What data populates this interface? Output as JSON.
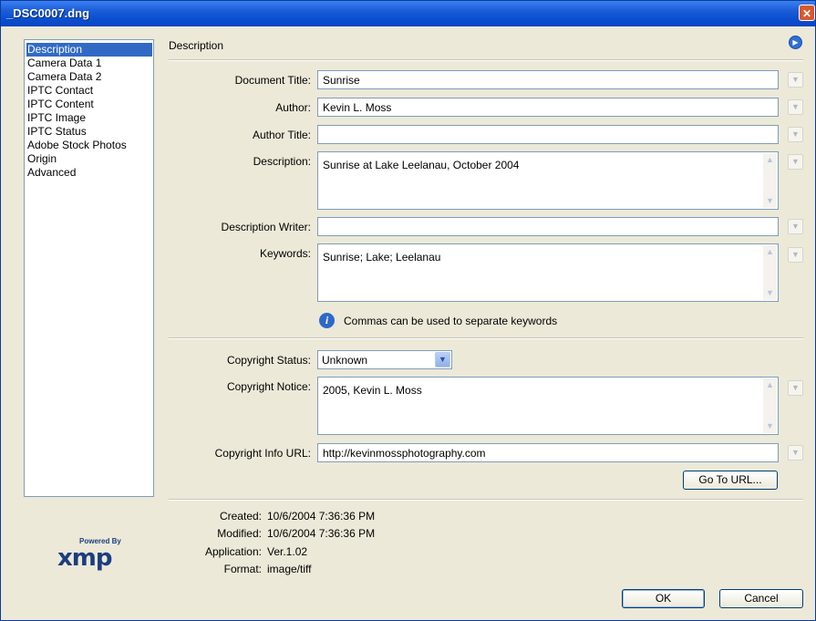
{
  "window": {
    "title": "_DSC0007.dng",
    "close_glyph": "✕"
  },
  "sidebar": {
    "items": [
      {
        "label": "Description",
        "selected": true
      },
      {
        "label": "Camera Data 1"
      },
      {
        "label": "Camera Data 2"
      },
      {
        "label": "IPTC Contact"
      },
      {
        "label": "IPTC Content"
      },
      {
        "label": "IPTC Image"
      },
      {
        "label": "IPTC Status"
      },
      {
        "label": "Adobe Stock Photos"
      },
      {
        "label": "Origin"
      },
      {
        "label": "Advanced"
      }
    ]
  },
  "section": {
    "title": "Description",
    "menu_icon": "circle-arrow-icon"
  },
  "fields": {
    "document_title": {
      "label": "Document Title:",
      "value": "Sunrise"
    },
    "author": {
      "label": "Author:",
      "value": "Kevin L. Moss"
    },
    "author_title": {
      "label": "Author Title:",
      "value": ""
    },
    "description": {
      "label": "Description:",
      "value": "Sunrise at Lake Leelanau, October 2004"
    },
    "description_writer": {
      "label": "Description Writer:",
      "value": ""
    },
    "keywords": {
      "label": "Keywords:",
      "value": "Sunrise; Lake; Leelanau"
    }
  },
  "info": {
    "icon": "info-icon",
    "text": "Commas can be used to separate keywords"
  },
  "copyright": {
    "status": {
      "label": "Copyright Status:",
      "value": "Unknown"
    },
    "notice": {
      "label": "Copyright Notice:",
      "value": "2005, Kevin L. Moss"
    },
    "url": {
      "label": "Copyright Info URL:",
      "value": "http://kevinmossphotography.com"
    },
    "go_button": "Go To URL..."
  },
  "metadata": {
    "created": {
      "label": "Created:",
      "value": "10/6/2004 7:36:36 PM"
    },
    "modified": {
      "label": "Modified:",
      "value": "10/6/2004 7:36:36 PM"
    },
    "application": {
      "label": "Application:",
      "value": "Ver.1.02"
    },
    "format": {
      "label": "Format:",
      "value": "image/tiff"
    }
  },
  "logo": {
    "powered_by": "Powered By",
    "brand": "xmp"
  },
  "buttons": {
    "ok": "OK",
    "cancel": "Cancel"
  }
}
